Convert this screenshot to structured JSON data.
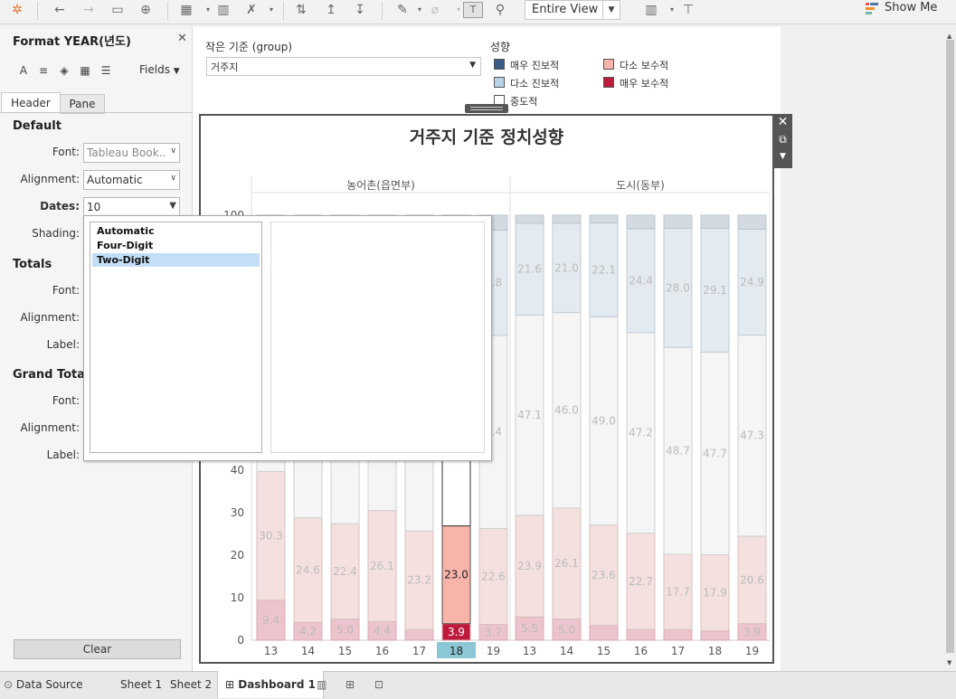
{
  "toolbar": {
    "entire_view": "Entire View",
    "show_me": "Show Me"
  },
  "format_pane": {
    "title": "Format YEAR(년도)",
    "fields_label": "Fields",
    "tabs": [
      "Header",
      "Pane"
    ],
    "sections": {
      "default": "Default",
      "totals": "Totals",
      "grand_totals": "Grand Totals"
    },
    "labels": {
      "font": "Font:",
      "alignment": "Alignment:",
      "dates": "Dates:",
      "shading": "Shading:",
      "label": "Label:"
    },
    "values": {
      "font": "Tableau Book..",
      "alignment": "Automatic",
      "dates": "10"
    },
    "dates_options": [
      "Automatic",
      "Four-Digit",
      "Two-Digit"
    ],
    "dates_selected": "Two-Digit",
    "clear": "Clear"
  },
  "filter": {
    "label": "작은 기준 (group)",
    "value": "거주지"
  },
  "legend": {
    "title": "성향",
    "items": [
      {
        "label": "매우 진보적",
        "color": "#3b5b87"
      },
      {
        "label": "다소 진보적",
        "color": "#b8d2e8"
      },
      {
        "label": "중도적",
        "color": "#ffffff"
      },
      {
        "label": "다소 보수적",
        "color": "#f8b4a8"
      },
      {
        "label": "매우 보수적",
        "color": "#be1a3c"
      }
    ]
  },
  "chart_data": {
    "type": "bar",
    "title": "거주지 기준 정치성향",
    "panels": [
      "농어촌(읍면부)",
      "도시(동부)"
    ],
    "categories": [
      "13",
      "14",
      "15",
      "16",
      "17",
      "18",
      "19"
    ],
    "highlighted": {
      "panel": "농어촌(읍면부)",
      "category": "18"
    },
    "y_ticks": [
      0,
      10,
      20,
      30,
      40,
      100
    ],
    "ylim": [
      0,
      100
    ],
    "series": [
      {
        "name": "매우 보수적",
        "panel_values": [
          [
            9.4,
            4.2,
            5.0,
            4.4,
            2.5,
            3.9,
            3.7
          ],
          [
            5.5,
            5.0,
            3.5,
            2.5,
            2.5,
            2.2,
            3.9
          ]
        ]
      },
      {
        "name": "다소 보수적",
        "panel_values": [
          [
            30.3,
            24.6,
            22.4,
            26.1,
            23.2,
            23.0,
            22.6
          ],
          [
            23.9,
            26.1,
            23.6,
            22.7,
            17.7,
            17.9,
            20.6
          ]
        ]
      },
      {
        "name": "중도적",
        "panel_values": [
          [
            null,
            null,
            null,
            null,
            null,
            null,
            45.4
          ],
          [
            47.1,
            46.0,
            49.0,
            47.2,
            48.7,
            47.7,
            47.3
          ]
        ]
      },
      {
        "name": "다소 진보적",
        "panel_values": [
          [
            null,
            null,
            null,
            null,
            null,
            null,
            24.8
          ],
          [
            21.6,
            21.0,
            22.1,
            24.4,
            28.0,
            29.1,
            24.9
          ]
        ]
      }
    ],
    "data_labels": {
      "panel1": {
        "very_conservative": [
          "9.4",
          "4.2",
          "5.0",
          "4.4",
          "",
          "3.9",
          "3.7"
        ],
        "somewhat_conservative": [
          "30.3",
          "24.6",
          "22.4",
          "26.1",
          "23.2",
          "23.0",
          "22.6"
        ],
        "moderate": [
          "",
          "",
          "",
          "",
          "",
          "",
          "5.4"
        ],
        "somewhat_progressive": [
          "",
          "",
          "",
          "",
          "",
          "",
          "4.8"
        ]
      },
      "panel2": {
        "very_conservative": [
          "5.5",
          "5.0",
          "",
          "",
          "",
          "",
          "3.9"
        ],
        "somewhat_conservative": [
          "23.9",
          "26.1",
          "23.6",
          "22.7",
          "17.7",
          "17.9",
          "20.6"
        ],
        "moderate": [
          "47.1",
          "46.0",
          "49.0",
          "47.2",
          "48.7",
          "47.7",
          "47.3"
        ],
        "somewhat_progressive": [
          "21.6",
          "21.0",
          "22.1",
          "24.4",
          "28.0",
          "29.1",
          "24.9"
        ]
      }
    }
  },
  "bottom_tabs": [
    "Data Source",
    "Sheet 1",
    "Sheet 2",
    "Dashboard 1"
  ]
}
